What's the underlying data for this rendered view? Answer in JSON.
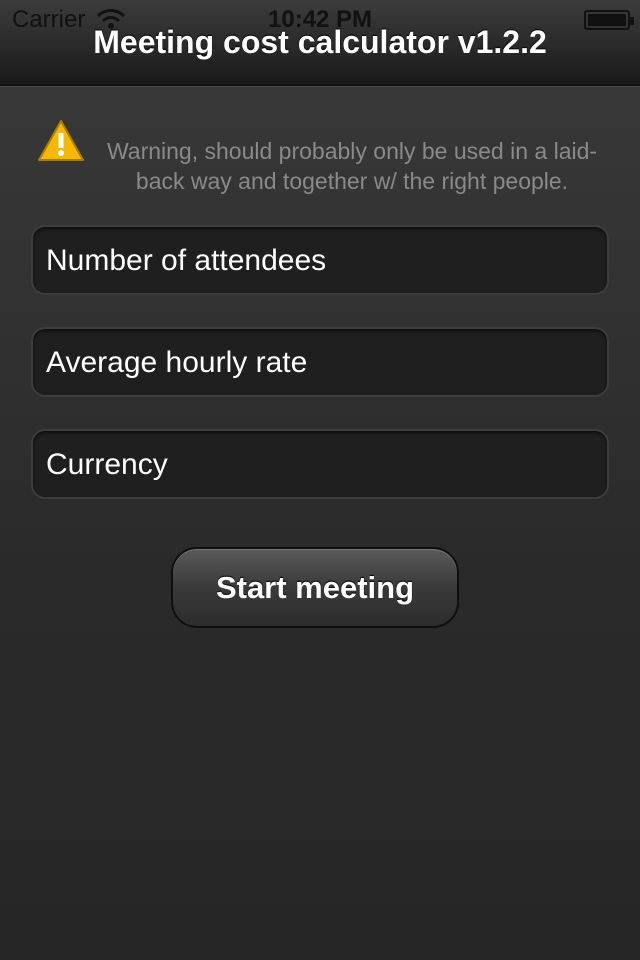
{
  "status_bar": {
    "carrier": "Carrier",
    "time": "10:42 PM"
  },
  "navbar": {
    "title": "Meeting cost calculator v1.2.2"
  },
  "warning": {
    "text": "Warning, should probably only be used in a laid-back way and together w/ the right people."
  },
  "form": {
    "attendees_placeholder": "Number of attendees",
    "rate_placeholder": "Average hourly rate",
    "currency_placeholder": "Currency"
  },
  "actions": {
    "start_label": "Start meeting"
  },
  "colors": {
    "background": "#2b2b2b",
    "field_background": "#1f1f1f",
    "warning_text": "#8a8a8a"
  },
  "icons": [
    "wifi-icon",
    "battery-icon",
    "warning-icon"
  ]
}
